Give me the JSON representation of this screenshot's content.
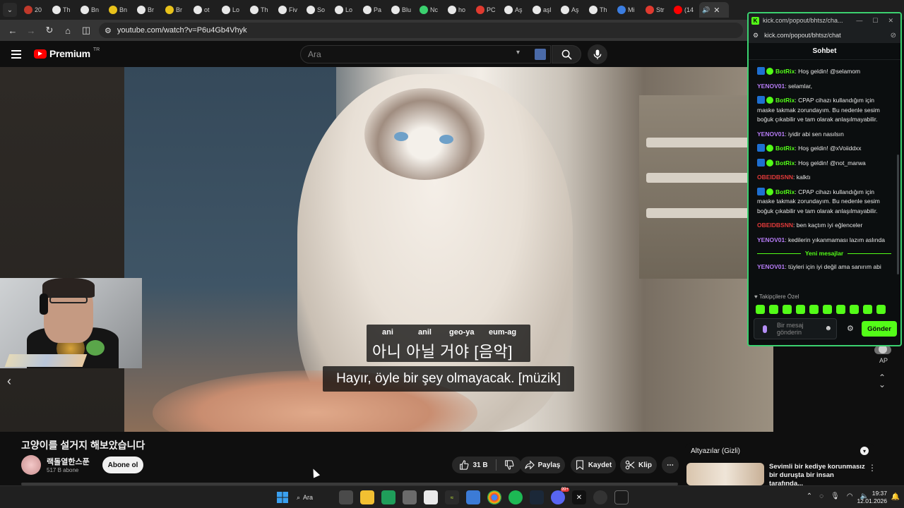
{
  "browser": {
    "tabs": [
      {
        "label": "20",
        "color": "#c0392b"
      },
      {
        "label": "Th",
        "color": "#e8e8e8"
      },
      {
        "label": "Bn",
        "color": "#e8e8e8"
      },
      {
        "label": "Bn",
        "color": "#e8c21b"
      },
      {
        "label": "Br",
        "color": "#e8e8e8"
      },
      {
        "label": "Br",
        "color": "#e8c21b"
      },
      {
        "label": "ot",
        "color": "#e8e8e8"
      },
      {
        "label": "Lo",
        "color": "#e8e8e8"
      },
      {
        "label": "Th",
        "color": "#e8e8e8"
      },
      {
        "label": "Fiv",
        "color": "#e8e8e8"
      },
      {
        "label": "So",
        "color": "#e8e8e8"
      },
      {
        "label": "Lo",
        "color": "#e8e8e8"
      },
      {
        "label": "Pa",
        "color": "#e8e8e8"
      },
      {
        "label": "Blu",
        "color": "#e8e8e8"
      },
      {
        "label": "Nc",
        "color": "#3bd16f"
      },
      {
        "label": "ho",
        "color": "#e8e8e8"
      },
      {
        "label": "PC",
        "color": "#e03a2f"
      },
      {
        "label": "Aş",
        "color": "#e8e8e8"
      },
      {
        "label": "aşl",
        "color": "#e8e8e8"
      },
      {
        "label": "Aş",
        "color": "#e8e8e8"
      },
      {
        "label": "Th",
        "color": "#e8e8e8"
      },
      {
        "label": "Mi",
        "color": "#3b7de0"
      },
      {
        "label": "Str",
        "color": "#e03a2f"
      },
      {
        "label": "(14",
        "color": "#ff0000"
      }
    ],
    "url": "youtube.com/watch?v=P6u4Gb4Vhyk"
  },
  "youtube": {
    "logo_text": "Premium",
    "logo_region": "TR",
    "search_placeholder": "Ara"
  },
  "video": {
    "sub_romanization": [
      "ani",
      "anil",
      "geo-ya",
      "eum-ag"
    ],
    "sub_korean": "아니 아닐 거야 [음악]",
    "sub_turkish": "Hayır, öyle bir şey olmayacak. [müzik]",
    "title": "고양이를 설거지 해보았습니다",
    "channel_name": "랙돌열한스푼",
    "channel_subs": "517 B abone",
    "subscribe_label": "Abone ol",
    "like_count": "31 B",
    "share_label": "Paylaş",
    "save_label": "Kaydet",
    "clip_label": "Klip"
  },
  "sidebar": {
    "autoplay_label": "AP",
    "subtitles_header": "Altyazılar (Gizli)",
    "rec_title": "Sevimli bir kediye korunmasız bir duruşta bir insan tarafında..."
  },
  "kick": {
    "window_title": "kick.com/popout/bhtsz/cha...",
    "url": "kick.com/popout/bhtsz/chat",
    "header": "Sohbet",
    "messages": [
      {
        "user": "BotRix",
        "text": "Hoş geldin! @selamom"
      },
      {
        "user": "YENOV01",
        "text": "selamlar,"
      },
      {
        "user": "BotRix",
        "text": "CPAP cihazı kullandığım için maske takmak zorundayım. Bu nedenle sesim boğuk çıkabilir ve tam olarak anlaşılmayabilir."
      },
      {
        "user": "YENOV01",
        "text": "iyidir abi sen nasılsın"
      },
      {
        "user": "BotRix",
        "text": "Hoş geldin! @xVoiiddxx"
      },
      {
        "user": "BotRix",
        "text": "Hoş geldin! @not_marwa"
      },
      {
        "user": "OBEIDBSNN",
        "text": "kalktı"
      },
      {
        "user": "BotRix",
        "text": "CPAP cihazı kullandığım için maske takmak zorundayım. Bu nedenle sesim boğuk çıkabilir ve tam olarak anlaşılmayabilir."
      },
      {
        "user": "OBEIDBSNN",
        "text": "ben kaçtım iyi eğlenceler"
      },
      {
        "user": "YENOV01",
        "text": "kedilerin yıkanmaması lazım aslında"
      }
    ],
    "new_messages_label": "Yeni mesajlar",
    "last_message": {
      "user": "YENOV01",
      "text": "tüyleri için iyi değil ama sanırım abi"
    },
    "followers_label": "Takipçilere Özel",
    "input_placeholder": "Bir mesaj gönderin",
    "send_label": "Gönder",
    "accent": "#53fc18"
  },
  "taskbar": {
    "search_label": "Ara",
    "time": "19:37",
    "date": "12.01.2026",
    "discord_badge": "99+"
  }
}
